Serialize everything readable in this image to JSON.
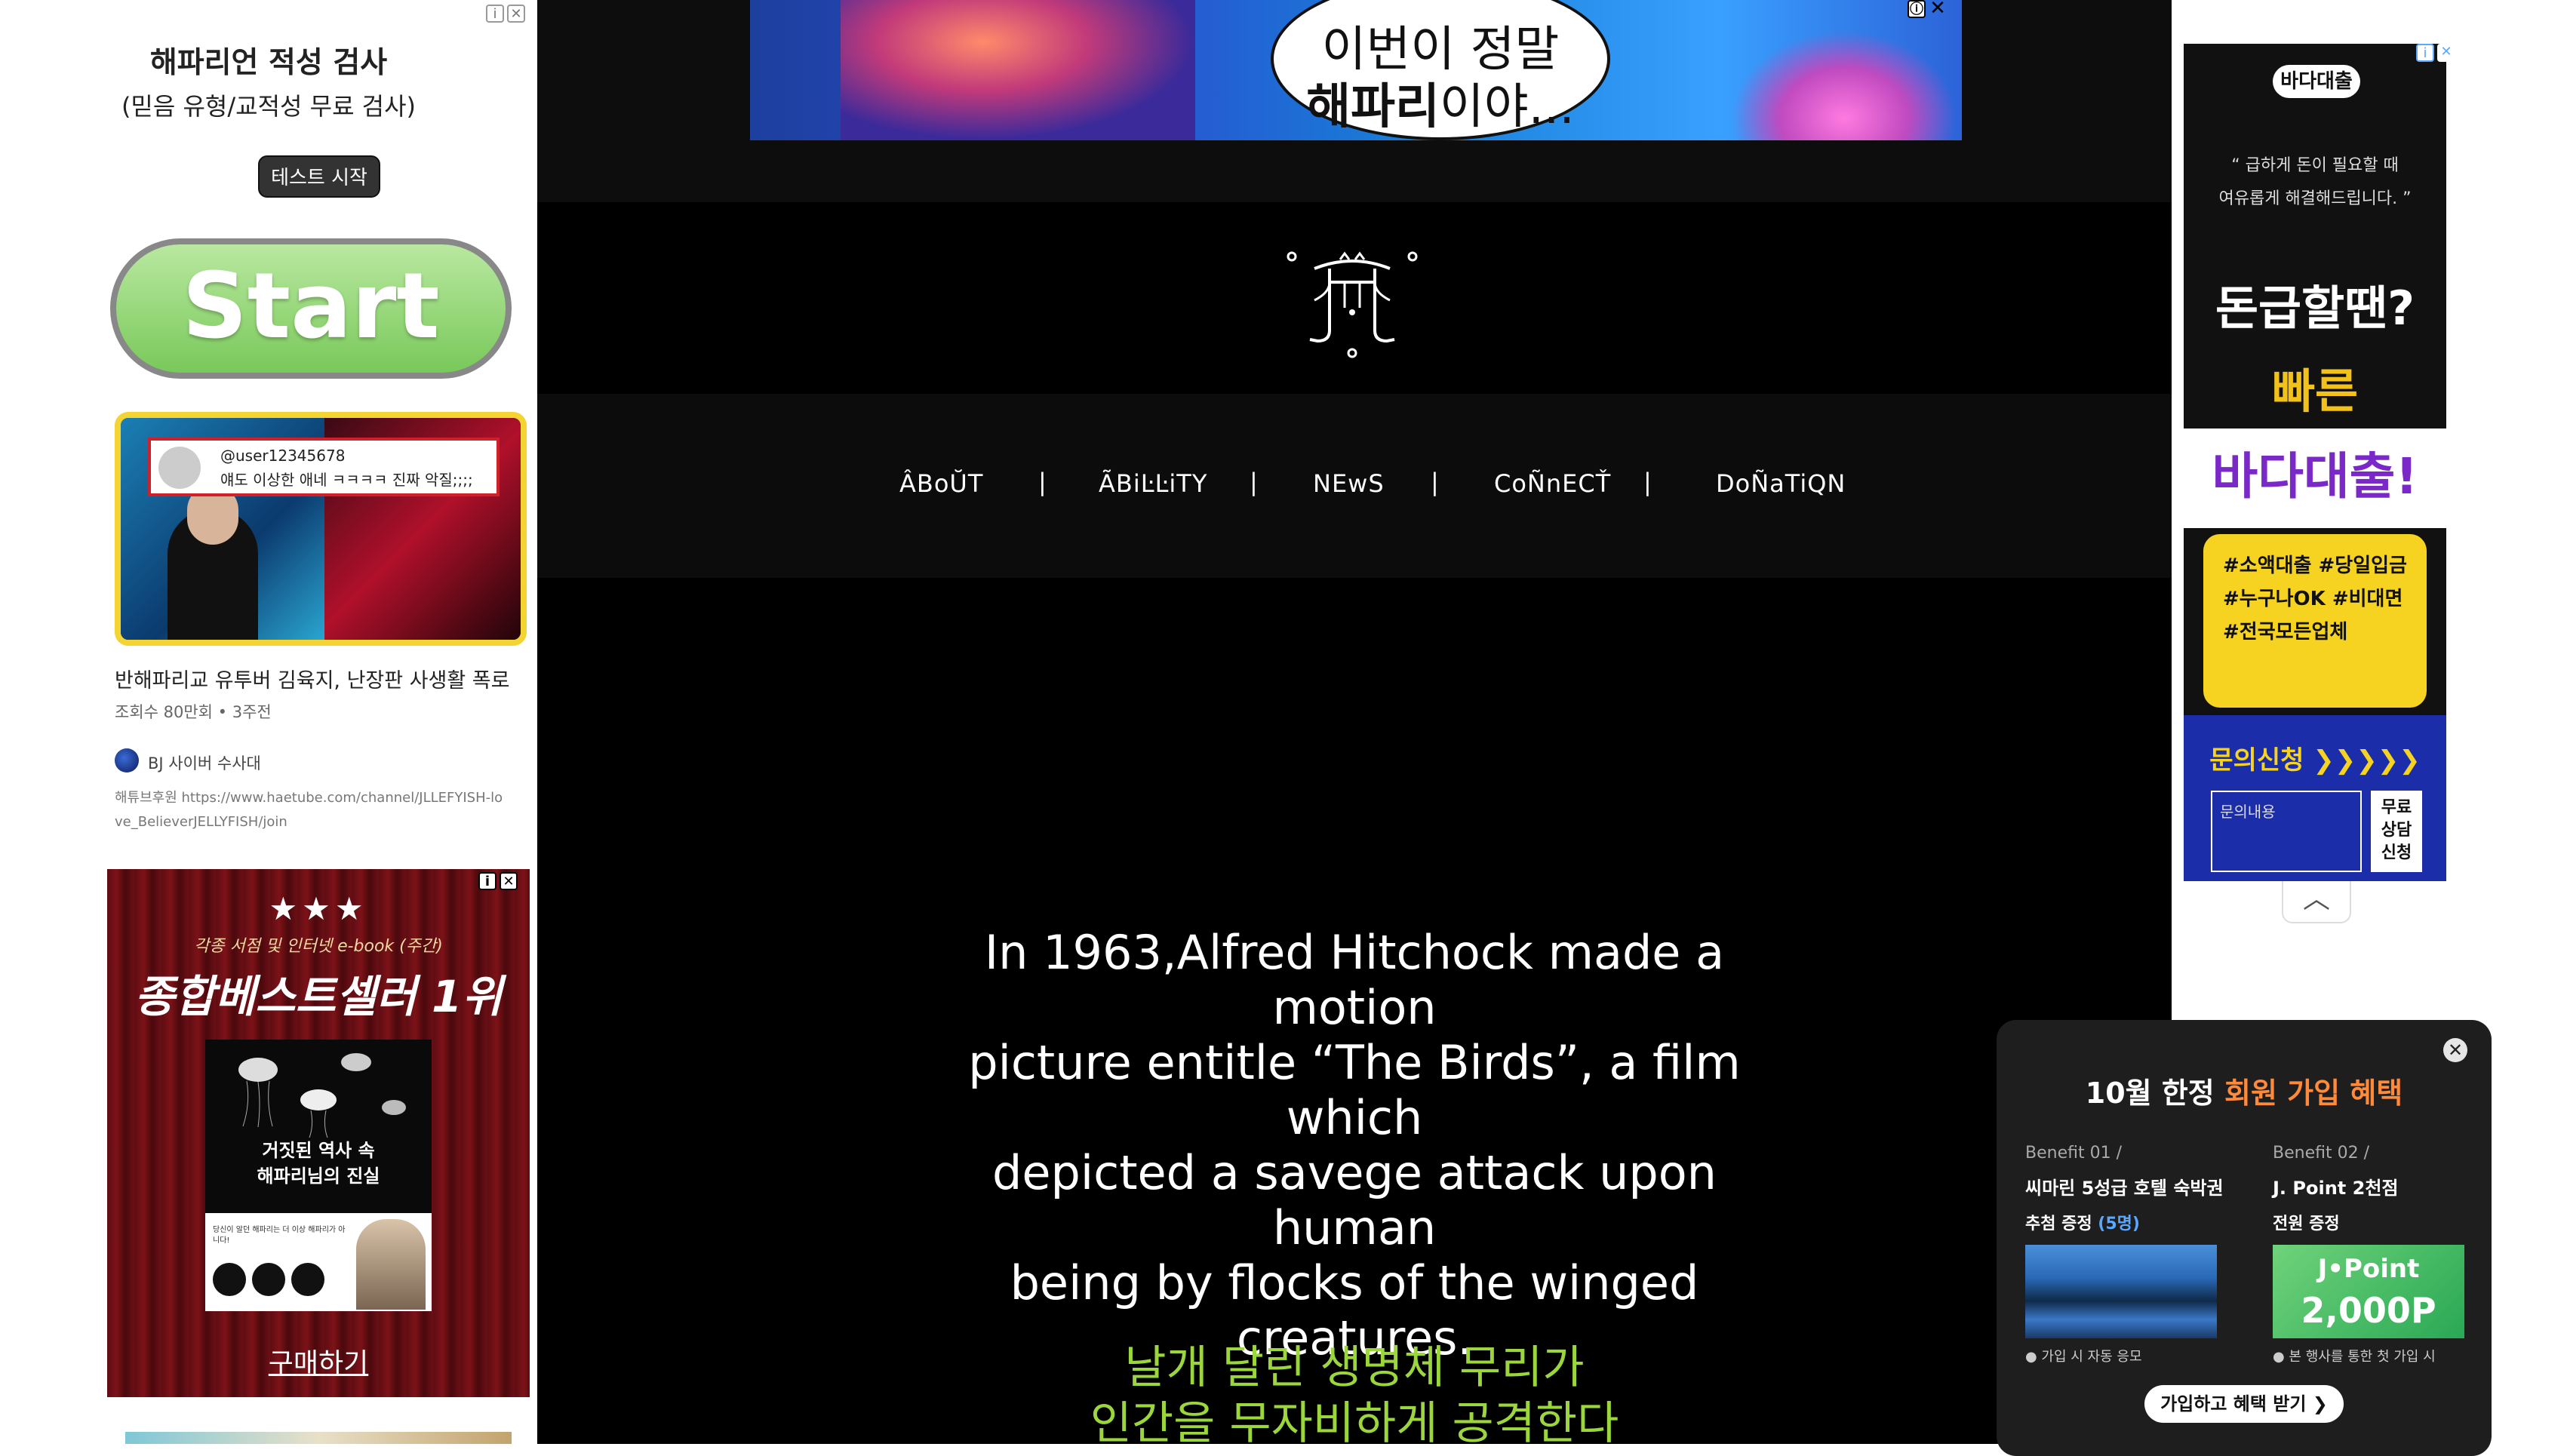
{
  "left_ads": {
    "quiz_title": "해파리언 적성 검사",
    "quiz_subtitle": "(믿음 유형/교적성 무료 검사)",
    "quiz_button": "테스트 시작",
    "start_button": "Start",
    "video": {
      "comment_user": "@user12345678",
      "comment_text": "얘도 이상한 애네 ㅋㅋㅋㅋ 진짜 악질;;;;",
      "title": "반해파리교 유투버 김육지, 난장판 사생활 폭로",
      "meta": "조회수 80만회 • 3주전",
      "channel": "BJ 사이버 수사대",
      "link": "해튜브후원 https://www.haetube.com/channel/JLLEFYISH-love_BelieverJELLYFISH/join"
    },
    "book": {
      "stars": "★★★",
      "tagline": "각종 서점 및 인터넷 e-book (주간)",
      "rank": "종합베스트셀러 1위",
      "cover_title_1": "거짓된 역사 속",
      "cover_title_2": "해파리님의 진실",
      "cover_note": "당신이 알던 해파리는 더 이상 해파리가 아니다!",
      "buy": "구매하기"
    }
  },
  "banner": {
    "line1": "이번이 정말",
    "line2_bold": "해파리",
    "line2_rest": "이야...",
    "info_icon": "ⓘ",
    "close_icon": "✕"
  },
  "nav": {
    "items": [
      "ÂBoŬT",
      "ÃBiĿĿiTY",
      "NEwS",
      "CoÑnECŤ",
      "DoÑaTiQN"
    ],
    "separator": "|"
  },
  "hero": {
    "line1": "In 1963,Alfred Hitchock made a motion",
    "line2": "picture entitle “The Birds”, a film which",
    "line3": "depicted a savege attack upon human",
    "line4": "being by flocks of the winged creatures.",
    "korean1": "날개 달린 생명체 무리가",
    "korean2": "인간을 무자비하게 공격한다"
  },
  "right_ad": {
    "badge": "바다대출",
    "quote1": "“ 급하게 돈이 필요할 때",
    "quote2": "여유롭게 해결해드립니다. ”",
    "big": "돈급할땐?",
    "fast": "빠른",
    "brand": "바다대출!",
    "tags": [
      "#소액대출 #당일입금",
      "#누구나OK #비대면",
      "#전국모든업체"
    ],
    "inquiry": "문의신청 ❯❯❯❯❯",
    "input_placeholder": "문의내용",
    "submit": "무료 상담 신청",
    "collapse": "︿"
  },
  "popup": {
    "close": "✕",
    "title_plain": "10월 한정 ",
    "title_highlight": "회원 가입 혜택",
    "benefit1": {
      "label": "Benefit 01 /",
      "name": "씨마린 5성급 호텔 숙박권",
      "desc": "추첨 증정 ",
      "desc_blue": "(5명)",
      "note": "● 가입 시 자동 응모"
    },
    "benefit2": {
      "label": "Benefit 02 /",
      "name": "J. Point 2천점",
      "desc": "전원 증정",
      "card_top": "J•Point",
      "card_bottom": "2,000P",
      "note": "● 본 행사를 통한 첫 가입 시"
    },
    "cta": "가입하고 혜택 받기 ❯"
  }
}
